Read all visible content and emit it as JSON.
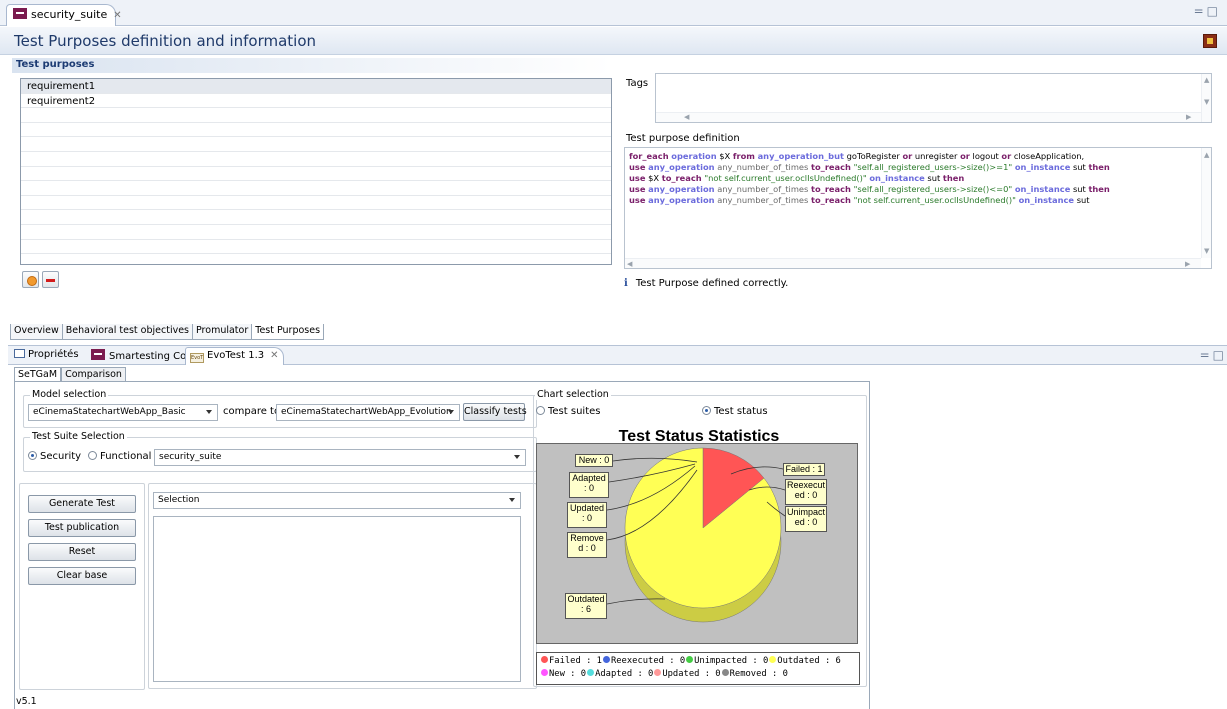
{
  "editor": {
    "tab_label": "security_suite",
    "title": "Test Purposes definition and information",
    "window_controls": "=□"
  },
  "test_purposes": {
    "header": "Test purposes",
    "items": [
      "requirement1",
      "requirement2"
    ],
    "tags_label": "Tags",
    "definition_label": "Test purpose definition",
    "status_message": "Test Purpose defined correctly."
  },
  "editor_pages": [
    "Overview",
    "Behavioral test objectives",
    "Promulator",
    "Test Purposes"
  ],
  "views": {
    "tabs": [
      "Propriétés",
      "Smartesting Console",
      "EvoTest 1.3"
    ],
    "evo_icon_text": "EvoT"
  },
  "setgam": {
    "tabs": [
      "SeTGaM",
      "Comparison"
    ],
    "model_selection": {
      "label": "Model selection",
      "model": "eCinemaStatechartWebApp_Basic",
      "compare_label": "compare to",
      "compare_model": "eCinemaStatechartWebApp_Evolution",
      "classify_button": "Classify tests"
    },
    "suite_selection": {
      "label": "Test Suite Selection",
      "radio_security": "Security",
      "radio_functional": "Functional",
      "suite": "security_suite"
    },
    "actions": [
      "Generate Test",
      "Test publication",
      "Reset",
      "Clear base"
    ],
    "selection_combo": "Selection",
    "version": "v5.1"
  },
  "chart_selection": {
    "label": "Chart selection",
    "radio_suites": "Test suites",
    "radio_status": "Test status",
    "selected": "Test status"
  },
  "chart_data": {
    "type": "pie",
    "title": "Test Status Statistics",
    "categories": [
      "Failed",
      "Reexecuted",
      "Unimpacted",
      "Outdated",
      "New",
      "Adapted",
      "Updated",
      "Removed"
    ],
    "values": [
      1,
      0,
      0,
      6,
      0,
      0,
      0,
      0
    ],
    "colors": {
      "Failed": "#ff5555",
      "Reexecuted": "#4466dd",
      "Unimpacted": "#44cc44",
      "Outdated": "#ffff55",
      "New": "#ff55ff",
      "Adapted": "#55dddd",
      "Updated": "#ff9999",
      "Removed": "#888888"
    },
    "slice_labels": {
      "New": "New : 0",
      "Adapted": "Adapted : 0",
      "Updated": "Updated : 0",
      "Removed": "Removed : 0",
      "Outdated": "Outdated : 6",
      "Failed": "Failed : 1",
      "Reexecuted": "Reexecuted : 0",
      "Unimpacted": "Unimpacted : 0"
    },
    "legend_row1": [
      "Failed : 1",
      "Reexecuted : 0",
      "Unimpacted : 0",
      "Outdated : 6"
    ],
    "legend_row2": [
      "New : 0",
      "Adapted : 0",
      "Updated : 0",
      "Removed : 0"
    ],
    "background": "#c0c0c0",
    "legend_position": "bottom"
  }
}
